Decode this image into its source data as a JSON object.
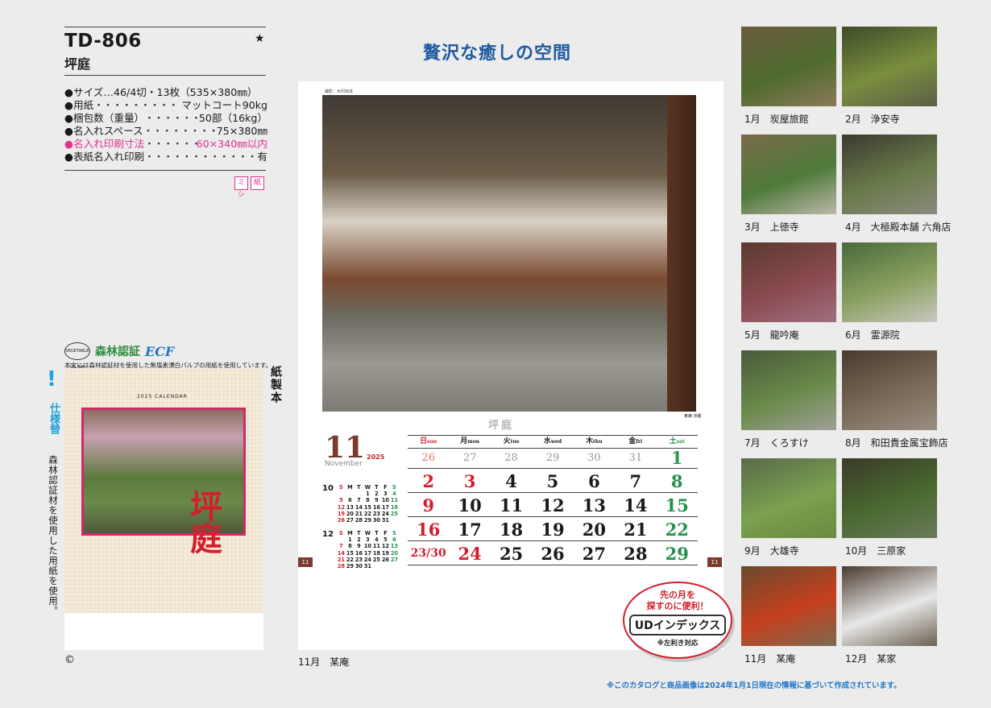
{
  "product": {
    "code": "TD-806",
    "name": "坪庭",
    "star": "★"
  },
  "specs": [
    {
      "label": "●サイズ…46/4切・13枚（535×380㎜）",
      "value": "",
      "pink": false,
      "nodots": true
    },
    {
      "label": "●用紙",
      "value": "マットコート90kg",
      "pink": false
    },
    {
      "label": "●梱包数（重量）",
      "value": "50部（16kg）",
      "pink": false
    },
    {
      "label": "●名入れスペース",
      "value": "75×380㎜",
      "pink": false
    },
    {
      "label": "●名入れ印刷寸法",
      "value": "60×340㎜以内",
      "pink": true
    },
    {
      "label": "●表紙名入れ印刷",
      "value": "有",
      "pink": false
    }
  ],
  "badges": [
    "ミシ",
    "紙"
  ],
  "logos": {
    "veg": "VEGETABLE OIL INK",
    "forest": "森林認証",
    "ecf": "ECF"
  },
  "logo_note": "本文には森林認証材を使用した無塩素漂白パルプの用紙を使用しています。",
  "side": {
    "excl": "!",
    "blue": "仕様替",
    "note": "森林認証材を使用した用紙を使用。",
    "paper": "紙製本"
  },
  "cover": {
    "calendar_label": "2025 CALENDAR",
    "title": "坪庭"
  },
  "copyright": "©",
  "headline": "贅沢な癒しの空間",
  "sheet": {
    "credit": "撮影：木村尚達",
    "title": "坪庭",
    "month_num": "11",
    "month_en": "November",
    "year": "2025",
    "page_left": "11",
    "page_right": "11",
    "photo_location": "某庵 京都"
  },
  "calendar": {
    "headers": [
      {
        "jp": "日",
        "en": "sun",
        "cls": "sun"
      },
      {
        "jp": "月",
        "en": "mon",
        "cls": ""
      },
      {
        "jp": "火",
        "en": "tue",
        "cls": ""
      },
      {
        "jp": "水",
        "en": "wed",
        "cls": ""
      },
      {
        "jp": "木",
        "en": "thu",
        "cls": ""
      },
      {
        "jp": "金",
        "en": "fri",
        "cls": ""
      },
      {
        "jp": "土",
        "en": "sat",
        "cls": "sat"
      }
    ],
    "prev_row": [
      "26",
      "27",
      "28",
      "29",
      "30",
      "31",
      "1"
    ],
    "weeks": [
      [
        "2",
        "3",
        "4",
        "5",
        "6",
        "7",
        "8"
      ],
      [
        "9",
        "10",
        "11",
        "12",
        "13",
        "14",
        "15"
      ],
      [
        "16",
        "17",
        "18",
        "19",
        "20",
        "21",
        "22"
      ],
      [
        "23/30",
        "24",
        "25",
        "26",
        "27",
        "28",
        "29"
      ]
    ],
    "red_days": [
      "2",
      "3",
      "9",
      "16",
      "23/30",
      "24"
    ]
  },
  "mini_calendars": [
    {
      "month": "10",
      "header": [
        "S",
        "M",
        "T",
        "W",
        "T",
        "F",
        "S"
      ],
      "rows": [
        [
          "",
          "",
          "",
          "1",
          "2",
          "3",
          "4"
        ],
        [
          "5",
          "6",
          "7",
          "8",
          "9",
          "10",
          "11"
        ],
        [
          "12",
          "13",
          "14",
          "15",
          "16",
          "17",
          "18"
        ],
        [
          "19",
          "20",
          "21",
          "22",
          "23",
          "24",
          "25"
        ],
        [
          "26",
          "27",
          "28",
          "29",
          "30",
          "31",
          ""
        ]
      ]
    },
    {
      "month": "12",
      "header": [
        "S",
        "M",
        "T",
        "W",
        "T",
        "F",
        "S"
      ],
      "rows": [
        [
          "",
          "1",
          "2",
          "3",
          "4",
          "5",
          "6"
        ],
        [
          "7",
          "8",
          "9",
          "10",
          "11",
          "12",
          "13"
        ],
        [
          "14",
          "15",
          "16",
          "17",
          "18",
          "19",
          "20"
        ],
        [
          "21",
          "22",
          "23",
          "24",
          "25",
          "26",
          "27"
        ],
        [
          "28",
          "29",
          "30",
          "31",
          "",
          "",
          ""
        ]
      ]
    }
  ],
  "ud_badge": {
    "line1": "先の月を",
    "line2": "探すのに便利！",
    "main": "UDインデックス",
    "note": "※左利き対応"
  },
  "main_caption": "11月　某庵",
  "thumbnails": [
    {
      "caption": "1月　炭屋旅館",
      "tone": [
        "#6b5a3e",
        "#4f6b2e",
        "#8a7a58"
      ]
    },
    {
      "caption": "2月　浄安寺",
      "tone": [
        "#3e4a2a",
        "#7a8e3e",
        "#5b5e48"
      ]
    },
    {
      "caption": "3月　上徳寺",
      "tone": [
        "#7a6a48",
        "#4e7a3a",
        "#bdb8aa"
      ]
    },
    {
      "caption": "4月　大極殿本舗 六角店",
      "tone": [
        "#3a3a30",
        "#6a7a4a",
        "#8a8a7e"
      ]
    },
    {
      "caption": "5月　龍吟庵",
      "tone": [
        "#5a3a30",
        "#8a4a50",
        "#a07080"
      ]
    },
    {
      "caption": "6月　霊源院",
      "tone": [
        "#4a6a3a",
        "#8aa060",
        "#c8c8c0"
      ]
    },
    {
      "caption": "7月　くろすけ",
      "tone": [
        "#4a5a3a",
        "#6a8a4a",
        "#a0a098"
      ]
    },
    {
      "caption": "8月　和田貴金属宝飾店",
      "tone": [
        "#4a3a2e",
        "#7a6a58",
        "#9a8e80"
      ]
    },
    {
      "caption": "9月　大雄寺",
      "tone": [
        "#5a6a4a",
        "#7aa050",
        "#6a8a40"
      ]
    },
    {
      "caption": "10月　三原家",
      "tone": [
        "#3a3a2a",
        "#4a6a30",
        "#6a7a5a"
      ]
    },
    {
      "caption": "11月　某庵",
      "tone": [
        "#6a4a2e",
        "#c5401e",
        "#7a6a50"
      ]
    },
    {
      "caption": "12月　某家",
      "tone": [
        "#4a3a2e",
        "#e8e8e8",
        "#6a6050"
      ]
    }
  ],
  "footnote": "※このカタログと商品画像は2024年1月1日現在の情報に基づいて作成されています。"
}
